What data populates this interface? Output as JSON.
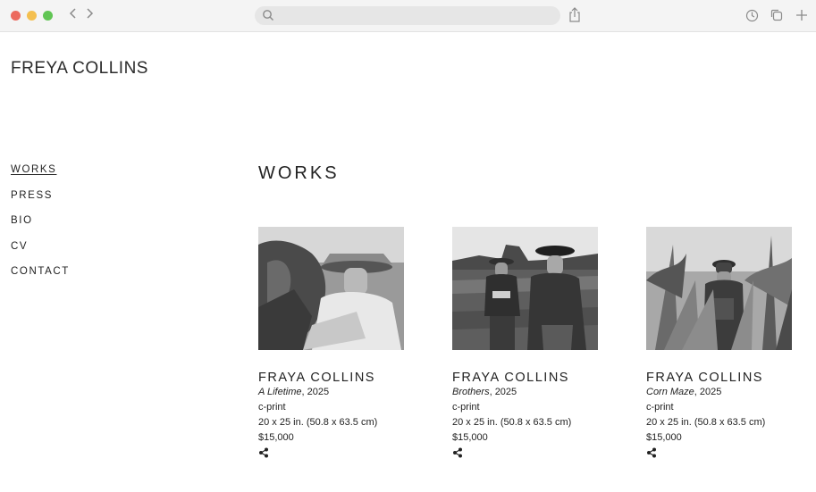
{
  "site": {
    "title": "FREYA COLLINS"
  },
  "nav": [
    {
      "label": "WORKS",
      "active": true
    },
    {
      "label": "PRESS",
      "active": false
    },
    {
      "label": "BIO",
      "active": false
    },
    {
      "label": "CV",
      "active": false
    },
    {
      "label": "CONTACT",
      "active": false
    }
  ],
  "main": {
    "heading": "WORKS",
    "works": [
      {
        "artist": "FRAYA COLLINS",
        "title": "A Lifetime",
        "year": ", 2025",
        "medium": "c-print",
        "dimensions": "20 x 25 in. (50.8 x 63.5 cm)",
        "price": "$15,000",
        "image": "black-and-white-photo-man-in-straw-hat"
      },
      {
        "artist": "FRAYA COLLINS",
        "title": "Brothers",
        "year": ", 2025",
        "medium": "c-print",
        "dimensions": "20 x 25 in. (50.8 x 63.5 cm)",
        "price": "$15,000",
        "image": "black-and-white-photo-two-men-in-field"
      },
      {
        "artist": "FRAYA COLLINS",
        "title": "Corn Maze",
        "year": ", 2025",
        "medium": "c-print",
        "dimensions": "20 x 25 in. (50.8 x 63.5 cm)",
        "price": "$15,000",
        "image": "black-and-white-photo-man-in-cornfield"
      }
    ]
  },
  "browser": {
    "icons": [
      "back-icon",
      "forward-icon",
      "search-icon",
      "share-icon",
      "history-icon",
      "tabs-icon",
      "new-tab-icon"
    ],
    "colors": {
      "close": "#ec6a5e",
      "minimize": "#f4bf4f",
      "zoom": "#61c554"
    }
  }
}
